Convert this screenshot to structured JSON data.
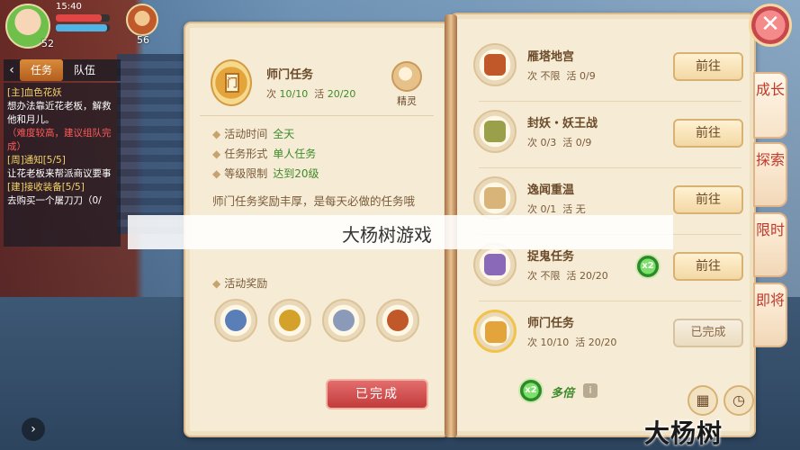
{
  "hud": {
    "status_time": "15:40",
    "player_level": "52",
    "pet_level": "56",
    "hp": 0.85,
    "mp": 0.95
  },
  "quest_panel": {
    "tabs": [
      "任务",
      "队伍"
    ],
    "lines": [
      {
        "text": "[主]血色花妖",
        "style": "q-title"
      },
      {
        "text": "想办法靠近花老板，解救他和月儿。",
        "style": ""
      },
      {
        "text": "（难度较高，建议组队完成）",
        "style": "q-hint"
      },
      {
        "text": "[周]通知[5/5]",
        "style": "q-title"
      },
      {
        "text": "让花老板来帮派商议要事",
        "style": ""
      },
      {
        "text": "[建]接收装备[5/5]",
        "style": "q-title"
      },
      {
        "text": "去购买一个屠刀刀（0/",
        "style": ""
      }
    ]
  },
  "selected": {
    "name": "师门任务",
    "meta_prefix": "次",
    "count": "10/10",
    "meta_mid": "活",
    "activity": "20/20",
    "spirit_label": "精灵",
    "info": [
      {
        "label": "活动时间",
        "value": "全天"
      },
      {
        "label": "任务形式",
        "value": "单人任务"
      },
      {
        "label": "等级限制",
        "value": "达到20级"
      }
    ],
    "description": "师门任务奖励丰厚，是每天必做的任务哦",
    "reward_title": "活动奖励",
    "rewards": [
      {
        "icon": "exp-orb-icon",
        "color": "#5a7fb8"
      },
      {
        "icon": "gold-coin-icon",
        "color": "#d4a12a"
      },
      {
        "icon": "silver-coin-icon",
        "color": "#8a9ab8"
      },
      {
        "icon": "treasure-bag-icon",
        "color": "#c0582a"
      }
    ],
    "done_label": "已完成"
  },
  "list": [
    {
      "name": "雁塔地宫",
      "count": "不限",
      "activity": "0/9",
      "button": "前往",
      "x2": false,
      "icon": "treasure-bag-icon",
      "color": "#c0582a"
    },
    {
      "name": "封妖・妖王战",
      "count": "0/3",
      "activity": "0/9",
      "button": "前往",
      "x2": false,
      "icon": "sword-icon",
      "color": "#9aa04a"
    },
    {
      "name": "逸闻重温",
      "count": "0/1",
      "activity": "无",
      "button": "前往",
      "x2": false,
      "icon": "scroll-icon",
      "color": "#d8b478"
    },
    {
      "name": "捉鬼任务",
      "count": "不限",
      "activity": "20/20",
      "button": "前往",
      "x2": true,
      "icon": "ghost-talisman-icon",
      "color": "#8a6ab8"
    },
    {
      "name": "师门任务",
      "count": "10/10",
      "activity": "20/20",
      "button": "已完成",
      "x2": false,
      "icon": "sect-banner-icon",
      "color": "#e3a43b",
      "selected": true
    }
  ],
  "list_meta_prefix": "次",
  "list_meta_mid": "活",
  "bottom": {
    "x2_label": "x2",
    "multi_label": "多倍",
    "info": "i"
  },
  "side_tabs": [
    "成长",
    "探索",
    "限时",
    "即将"
  ],
  "close": "✕",
  "watermark_banner": "大杨树游戏",
  "watermark_corner": "大杨树"
}
